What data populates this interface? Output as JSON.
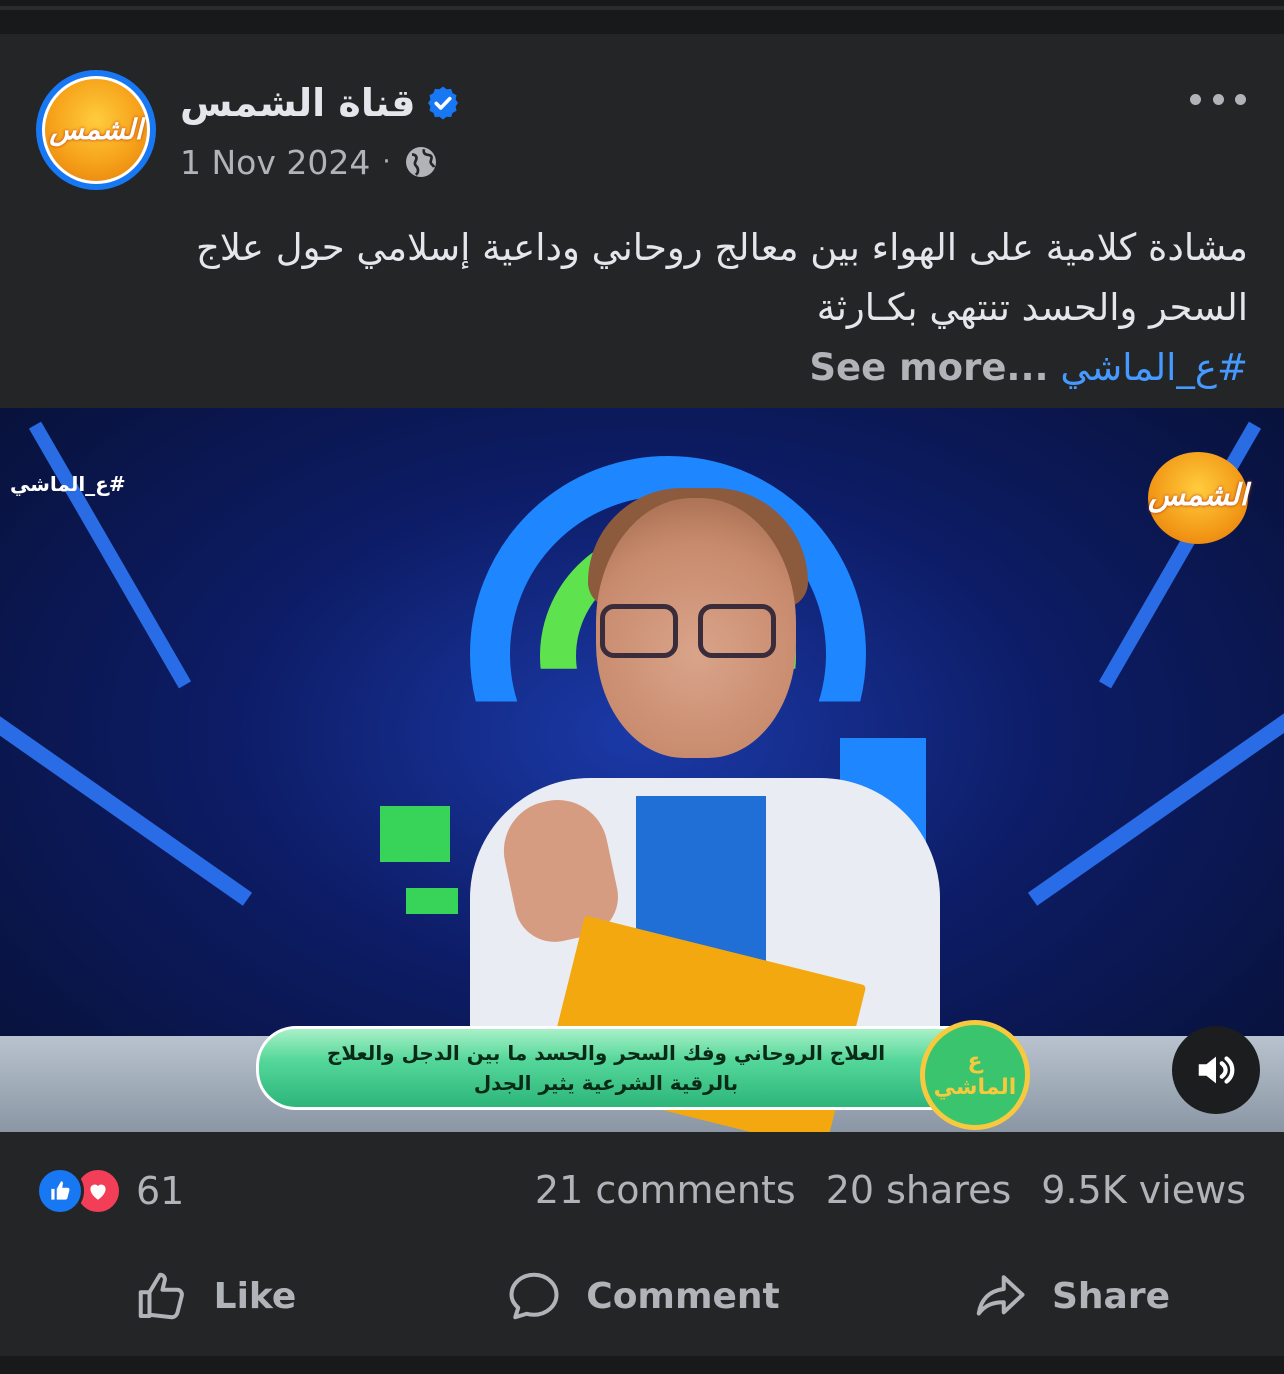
{
  "post": {
    "page_name": "قناة الشمس",
    "avatar_text": "الشمس",
    "date": "1 Nov 2024",
    "separator": "·",
    "caption_line1": "مشادة كلامية على الهواء بين معالج روحاني وداعية إسلامي حول علاج",
    "caption_line2": "السحر والحسد تنتهي بكـارثة",
    "hashtag": "#ع_الماشي",
    "see_more": "See more...",
    "colors": {
      "accent": "#1877f2",
      "link": "#4599ff",
      "card_bg": "#242526"
    },
    "icons": [
      "verified-badge-icon",
      "globe-icon",
      "more-options-icon"
    ]
  },
  "video": {
    "corner_tag": "#ع_الماشي",
    "channel_logo_text": "الشمس",
    "lower_third_line1": "العلاج الروحاني وفك السحر والحسد ما بين الدجل والعلاج",
    "lower_third_line2": "بالرقية الشرعية يثير الجدل",
    "show_badge_line1": "ع",
    "show_badge_line2": "الماشي",
    "sound_icon": "speaker-icon"
  },
  "engagement": {
    "reaction_count": "61",
    "comments": "21 comments",
    "shares": "20 shares",
    "views": "9.5K views"
  },
  "actions": {
    "like": "Like",
    "comment": "Comment",
    "share": "Share"
  }
}
